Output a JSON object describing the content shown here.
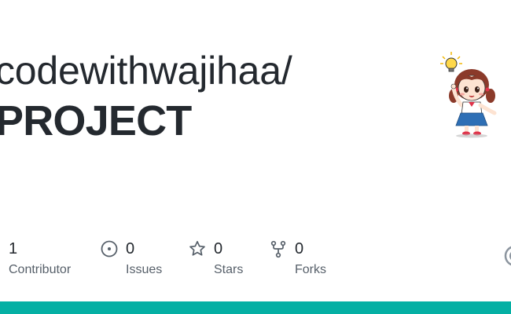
{
  "repo": {
    "owner": "codewithwajihaa/",
    "name": "PROJECT"
  },
  "stats": {
    "contributors": {
      "value": "1",
      "label": "Contributor"
    },
    "issues": {
      "value": "0",
      "label": "Issues",
      "icon": "issue-circle-icon"
    },
    "stars": {
      "value": "0",
      "label": "Stars",
      "icon": "star-icon"
    },
    "forks": {
      "value": "0",
      "label": "Forks",
      "icon": "fork-icon"
    }
  },
  "colors": {
    "accent_bar": "#04b0a4",
    "text_primary": "#24292f",
    "text_secondary": "#57606a"
  }
}
